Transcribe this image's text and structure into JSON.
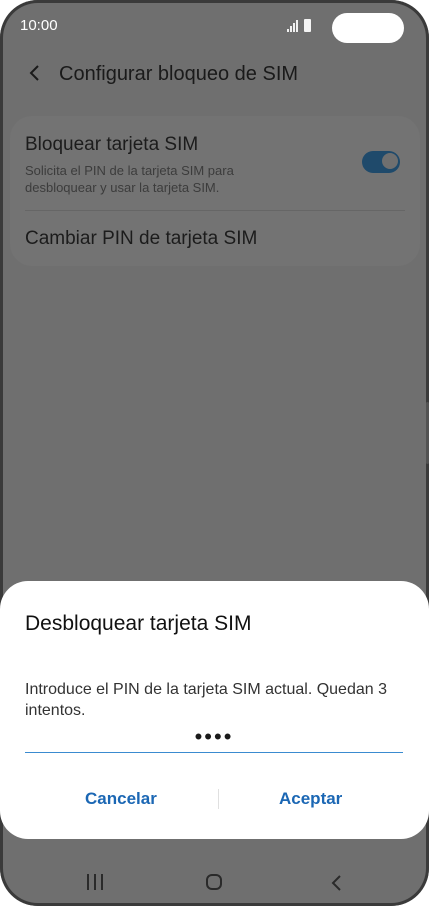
{
  "status_bar": {
    "time": "10:00",
    "icons": [
      "signal-icon",
      "battery-icon"
    ]
  },
  "app_bar": {
    "back_icon": "back-arrow-icon",
    "title": "Configurar bloqueo de SIM"
  },
  "settings": {
    "lock_sim": {
      "title": "Bloquear tarjeta SIM",
      "description": "Solicita el PIN de la tarjeta SIM para desbloquear y usar la tarjeta SIM.",
      "enabled": true
    },
    "change_pin": {
      "title": "Cambiar PIN de tarjeta SIM"
    }
  },
  "dialog": {
    "title": "Desbloquear tarjeta SIM",
    "message": "Introduce el PIN de la tarjeta SIM actual. Quedan 3 intentos.",
    "pin_value": "••••",
    "cancel_label": "Cancelar",
    "accept_label": "Aceptar"
  },
  "nav_bar": {
    "icons": [
      "recents-icon",
      "home-icon",
      "back-icon"
    ]
  },
  "colors": {
    "accent": "#1b67b4",
    "scrim_background": "#6f6f6f",
    "dialog_background": "#ffffff"
  }
}
